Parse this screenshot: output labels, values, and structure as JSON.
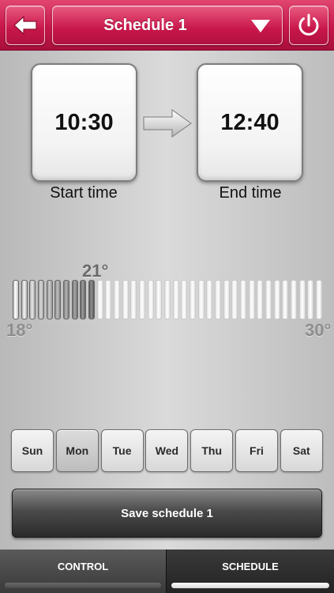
{
  "header": {
    "schedule_title": "Schedule 1"
  },
  "times": {
    "start_value": "10:30",
    "start_label": "Start time",
    "end_value": "12:40",
    "end_label": "End time"
  },
  "temperature": {
    "current_label": "21°",
    "min_label": "18°",
    "max_label": "30°",
    "current": 21,
    "min": 18,
    "max": 30,
    "segments": 37,
    "filled_segments": 10
  },
  "days": [
    {
      "label": "Sun",
      "selected": false
    },
    {
      "label": "Mon",
      "selected": true
    },
    {
      "label": "Tue",
      "selected": false
    },
    {
      "label": "Wed",
      "selected": false
    },
    {
      "label": "Thu",
      "selected": false
    },
    {
      "label": "Fri",
      "selected": false
    },
    {
      "label": "Sat",
      "selected": false
    }
  ],
  "save_label": "Save schedule 1",
  "tabs": {
    "control": "CONTROL",
    "schedule": "SCHEDULE",
    "active": "schedule"
  },
  "colors": {
    "header": "#c8164a",
    "button_border": "#f2c3d0"
  }
}
